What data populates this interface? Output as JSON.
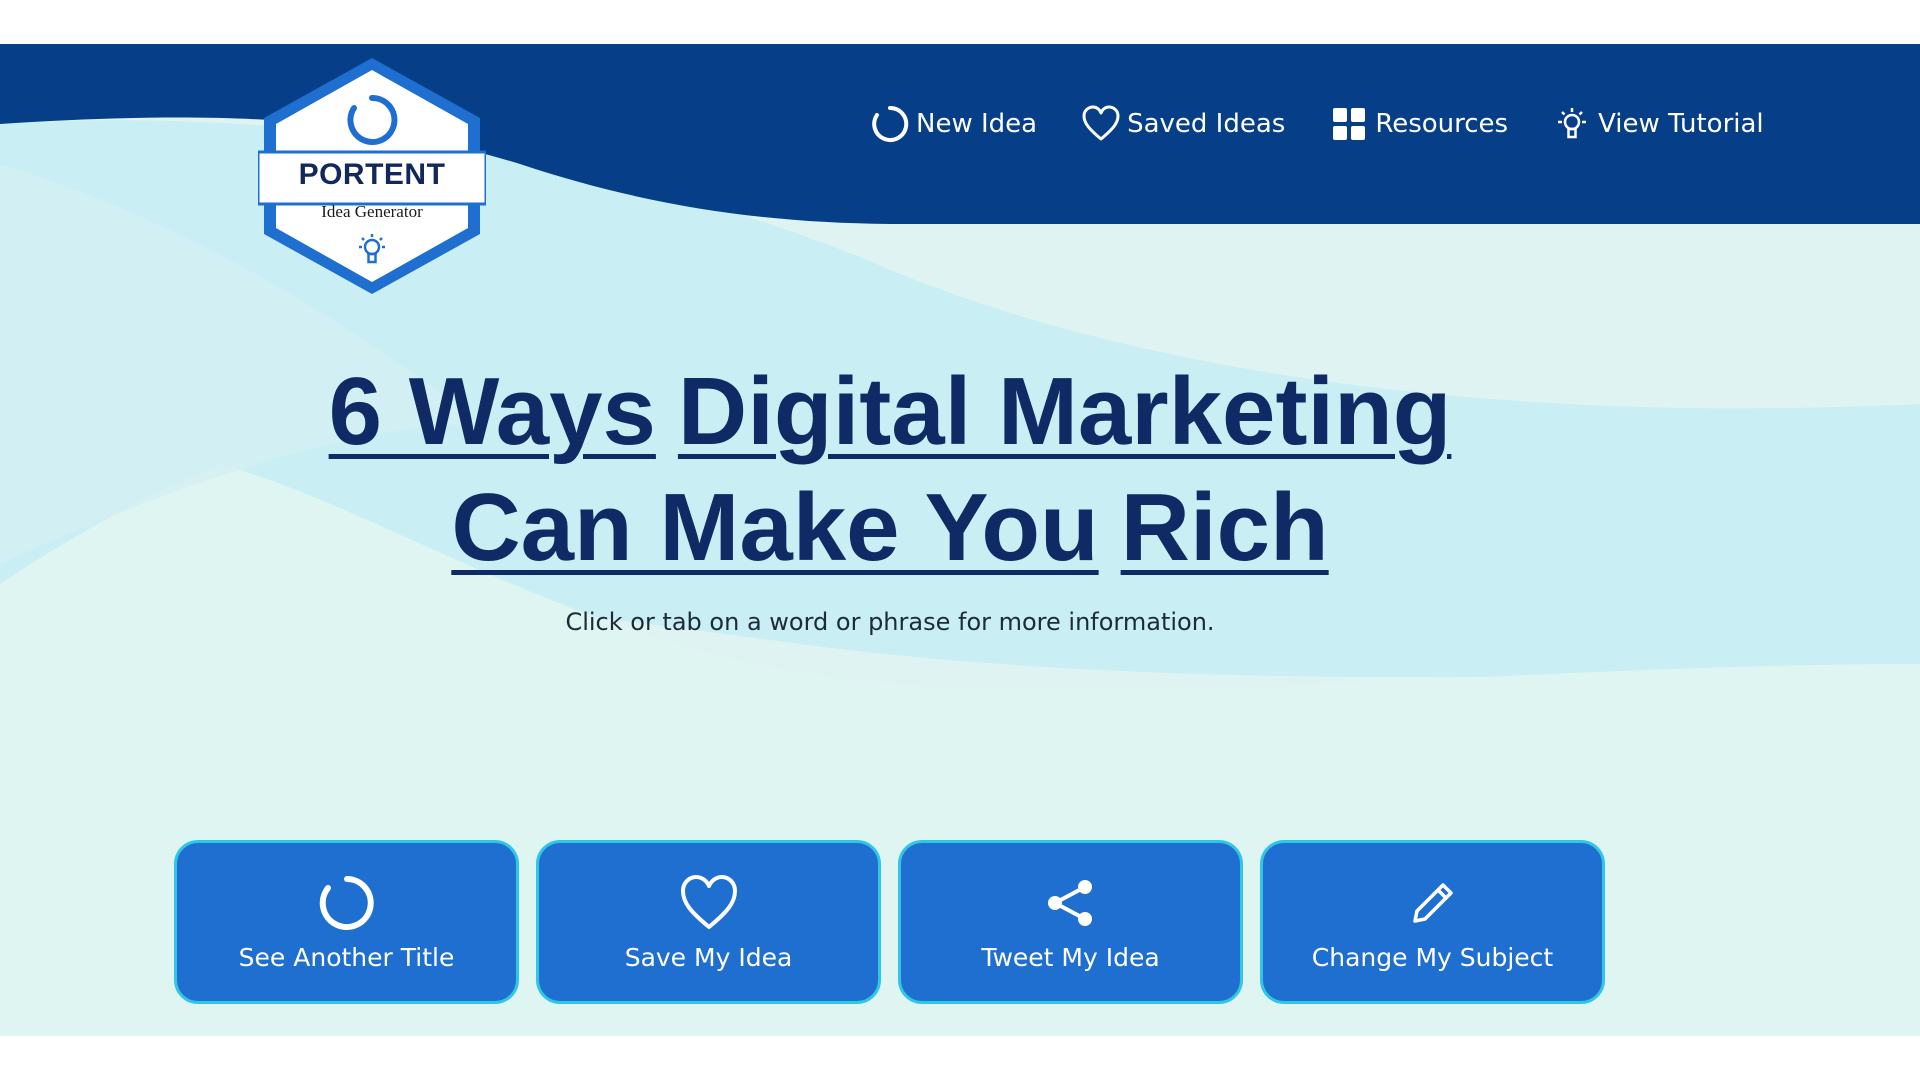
{
  "colors": {
    "header_navy": "#063f88",
    "button_blue": "#1f6fd1",
    "button_border": "#31c6e6",
    "headline_navy": "#0f2a64",
    "background_light": "#dff4f2"
  },
  "logo": {
    "brand": "PORTENT",
    "subtitle": "Idea Generator",
    "icons": [
      "refresh-icon",
      "lightbulb-icon"
    ]
  },
  "nav": {
    "items": [
      {
        "label": "New Idea",
        "icon": "refresh-icon"
      },
      {
        "label": "Saved Ideas",
        "icon": "heart-icon"
      },
      {
        "label": "Resources",
        "icon": "grid-icon"
      },
      {
        "label": "View Tutorial",
        "icon": "lightbulb-icon"
      }
    ]
  },
  "headline": {
    "phrases": [
      "6 Ways",
      "Digital Marketing",
      "Can Make You",
      "Rich"
    ]
  },
  "hint": "Click or tab on a word or phrase for more information.",
  "actions": [
    {
      "label": "See Another Title",
      "icon": "refresh-icon"
    },
    {
      "label": "Save My Idea",
      "icon": "heart-icon"
    },
    {
      "label": "Tweet My Idea",
      "icon": "share-icon"
    },
    {
      "label": "Change My Subject",
      "icon": "pencil-icon"
    }
  ]
}
